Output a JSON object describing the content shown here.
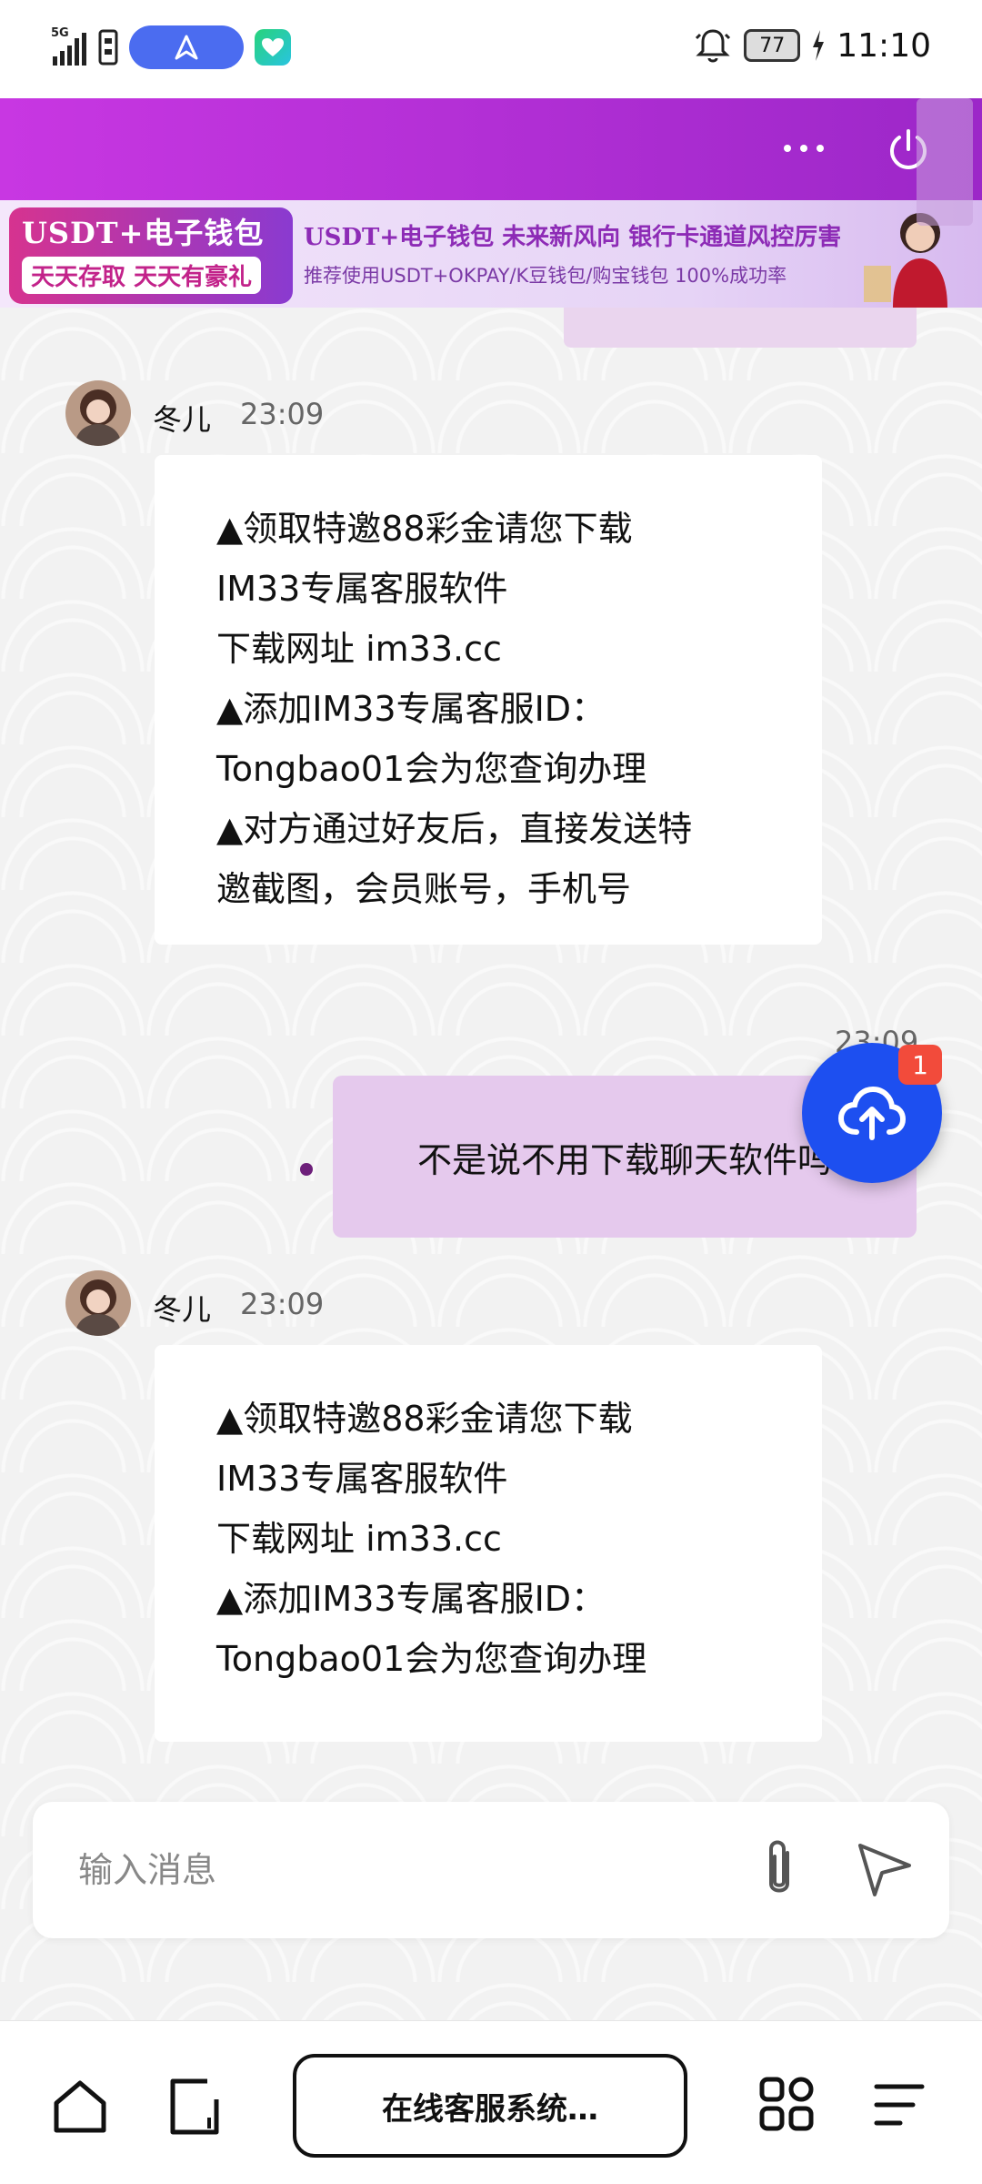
{
  "status_bar": {
    "network": "5G",
    "battery": "77",
    "time": "11:10"
  },
  "header": {
    "more_icon": "more-dots-icon",
    "power_icon": "power-icon"
  },
  "banner": {
    "badge_line1": "USDT+电子钱包",
    "badge_line2": "天天存取 天天有豪礼",
    "title": "USDT+电子钱包  未来新风向  银行卡通道风控厉害",
    "subtitle": "推荐使用USDT+OKPAY/K豆钱包/购宝钱包  100%成功率"
  },
  "messages": [
    {
      "direction": "in",
      "sender": "冬儿",
      "time": "23:09",
      "lines": [
        "▲领取特邀88彩金请您下载",
        "IM33专属客服软件",
        "下载网址 im33.cc",
        "▲添加IM33专属客服ID：",
        "Tongbao01会为您查询办理",
        "▲对方通过好友后，直接发送特",
        "邀截图，会员账号，手机号"
      ]
    },
    {
      "direction": "out",
      "time": "23:09",
      "text": "不是说不用下载聊天软件吗"
    },
    {
      "direction": "in",
      "sender": "冬儿",
      "time": "23:09",
      "lines": [
        "▲领取特邀88彩金请您下载",
        "IM33专属客服软件",
        "下载网址 im33.cc",
        "▲添加IM33专属客服ID：",
        "Tongbao01会为您查询办理"
      ]
    }
  ],
  "fab": {
    "icon": "cloud-upload-icon",
    "badge": "1"
  },
  "composer": {
    "placeholder": "输入消息",
    "attach_icon": "paperclip-icon",
    "send_icon": "send-icon"
  },
  "bottom_nav": {
    "url_label": "在线客服系统…"
  },
  "colors": {
    "header": "#c837e2",
    "outgoing_bubble": "#e5c9ed",
    "fab": "#1d4ff0",
    "badge": "#f24b3b"
  }
}
